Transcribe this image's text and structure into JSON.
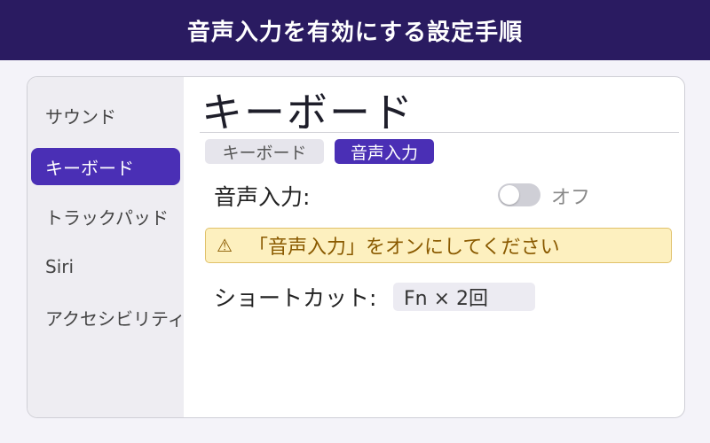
{
  "header": {
    "title": "音声入力を有効にする設定手順"
  },
  "sidebar": {
    "items": [
      {
        "label": "サウンド",
        "active": false
      },
      {
        "label": "キーボード",
        "active": true
      },
      {
        "label": "トラックパッド",
        "active": false
      },
      {
        "label": "Siri",
        "active": false
      },
      {
        "label": "アクセシビリティ",
        "active": false
      }
    ]
  },
  "main": {
    "title": "キーボード",
    "tabs": [
      {
        "label": "キーボード",
        "active": false
      },
      {
        "label": "音声入力",
        "active": true
      }
    ],
    "dictation": {
      "label": "音声入力:",
      "toggle_state": "オフ",
      "toggle_on": false
    },
    "warning": {
      "icon": "warning-triangle-icon",
      "icon_glyph": "⚠",
      "text": "「音声入力」をオンにしてください"
    },
    "shortcut": {
      "label": "ショートカット:",
      "value": "Fn × 2回"
    }
  },
  "colors": {
    "header_bg": "#2a1b61",
    "accent": "#4a2fb5",
    "warning_bg": "#fdf0bf",
    "warning_text": "#8a5a00"
  }
}
